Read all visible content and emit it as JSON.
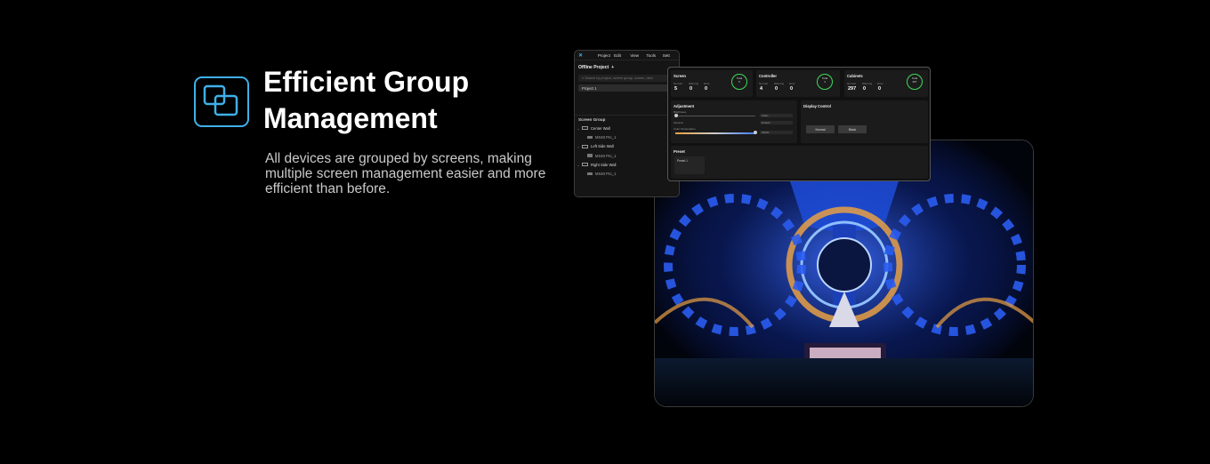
{
  "hero": {
    "icon": "overlapping-squares-icon",
    "title": "Efficient Group Management",
    "description": "All devices are grouped by screens, making multiple screen management easier and more efficient than before."
  },
  "colors": {
    "accent": "#3fb0e8",
    "status_green": "#3ddc5a",
    "background": "#000000"
  },
  "app": {
    "menu": [
      "Project",
      "Edit",
      "View",
      "Tools",
      "Sett"
    ],
    "sidebar": {
      "header": "Offline Project",
      "add_icon": "plus-icon",
      "search_placeholder": "Search by project, screen group, screen, devi",
      "project": "Project 1",
      "screen_group_title": "Screen Group",
      "groups": [
        {
          "name": "Center Wall",
          "device": "MX40 Pro_1"
        },
        {
          "name": "Left Side Wall",
          "device": "MX40 Pro_1"
        },
        {
          "name": "Right Side Wall",
          "device": "MX40 Pro_1"
        }
      ]
    },
    "stats": [
      {
        "label": "Screen",
        "sub": [
          "Normal",
          "Warning",
          "Error"
        ],
        "values": [
          "5",
          "0",
          "0"
        ],
        "ring_label": "Total",
        "ring_value": "5"
      },
      {
        "label": "Controller",
        "sub": [
          "Normal",
          "Warning",
          "Error"
        ],
        "values": [
          "4",
          "0",
          "0"
        ],
        "ring_label": "Total",
        "ring_value": "4"
      },
      {
        "label": "Cabinets",
        "sub": [
          "Normal",
          "Warning",
          "Error"
        ],
        "values": [
          "297",
          "0",
          "0"
        ],
        "ring_label": "Total",
        "ring_value": "297"
      }
    ],
    "adjustment": {
      "title": "Adjustment",
      "brightness_label": "Brightness",
      "gamma_label": "Gamma",
      "color_temp_label": "Color Temperature",
      "dropdowns": [
        "Static",
        "Default",
        "6500K"
      ]
    },
    "display_control": {
      "title": "Display Control",
      "buttons": [
        "Normal",
        "Black"
      ]
    },
    "preset": {
      "title": "Preset",
      "item": "Preset 1"
    }
  }
}
